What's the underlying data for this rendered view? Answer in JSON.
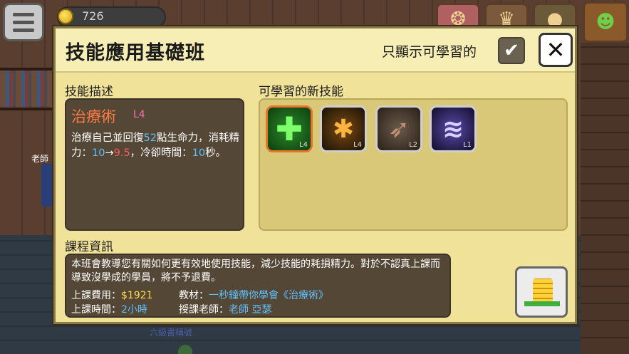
{
  "hud": {
    "coins": "726"
  },
  "background": {
    "npc_label": "老師",
    "bottom_text": "六級書稱號"
  },
  "dialog": {
    "title": "技能應用基礎班",
    "filter_label": "只顯示可學習的",
    "filter_checked": true,
    "close_symbol": "✕"
  },
  "skill_description": {
    "section_label": "技能描述",
    "name": "治療術",
    "level": "L4",
    "text_part1": "治療自己並回復",
    "heal_amount": "52",
    "text_part2": "點生命力，消耗精力：",
    "energy_from": "10",
    "arrow": "→",
    "energy_to": "9.5",
    "text_part3": "，冷卻時間：",
    "cooldown": "10",
    "text_part4": "秒。"
  },
  "new_skills": {
    "section_label": "可學習的新技能",
    "items": [
      {
        "icon": "heal-cross-icon",
        "level": "L4",
        "selected": true
      },
      {
        "icon": "paw-icon",
        "level": "L4",
        "selected": false
      },
      {
        "icon": "winged-boot-icon",
        "level": "L2",
        "selected": false
      },
      {
        "icon": "tornado-icon",
        "level": "L1",
        "selected": false
      }
    ]
  },
  "course_info": {
    "section_label": "課程資訊",
    "description": "本班會教導您有關如何更有效地使用技能，減少技能的耗損精力。對於不認真上課而導致沒學成的學員，將不予退費。",
    "fee_label": "上課費用：",
    "fee_value": "$1921",
    "material_label": "教材：",
    "material_value": "一秒鐘帶你學會《治療術》",
    "time_label": "上課時間：",
    "time_value": "2小時",
    "teacher_label": "授課老師：",
    "teacher_value": "老師 亞瑟"
  },
  "colors": {
    "panel_bg": "#f1e29a",
    "dark_panel": "#544736",
    "skill_name": "#ff7a45",
    "accent_blue": "#5fc0ff",
    "accent_red": "#ff5a5a",
    "fee_yellow": "#ffd94a",
    "selected_border": "#e8742a"
  }
}
